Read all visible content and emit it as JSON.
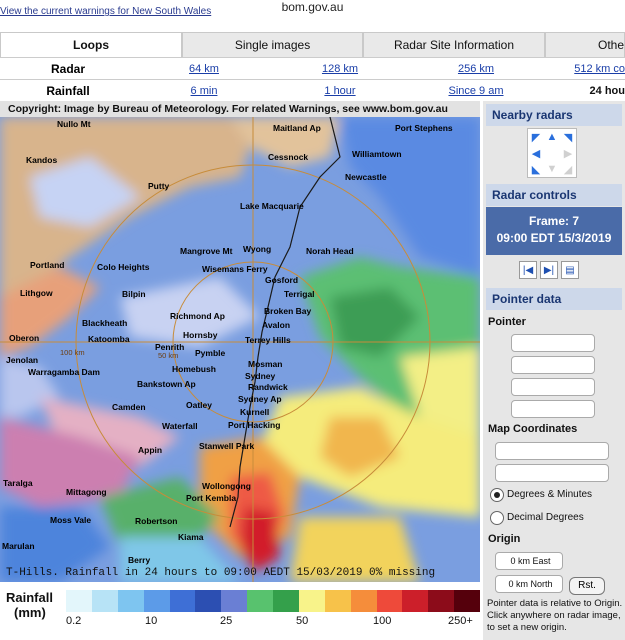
{
  "browser": {
    "url": "bom.gov.au",
    "warnings_link": "View the current warnings for New South Wales"
  },
  "tabs": [
    {
      "label": "Loops",
      "active": true
    },
    {
      "label": "Single images",
      "active": false
    },
    {
      "label": "Radar Site Information",
      "active": false
    },
    {
      "label": "Othe",
      "active": false
    }
  ],
  "radar_row": {
    "label": "Radar",
    "options": [
      "64 km",
      "128 km",
      "256 km",
      "512 km co"
    ]
  },
  "rainfall_row": {
    "label": "Rainfall",
    "options": [
      "6 min",
      "1 hour",
      "Since 9 am"
    ],
    "current": "24 hou"
  },
  "map": {
    "copyright": "Copyright: Image by Bureau of Meteorology. For related Warnings, see www.bom.gov.au",
    "caption": "T-Hills. Rainfall in 24 hours to 09:00 AEDT 15/03/2019 0% missing",
    "range_labels": [
      "100 km",
      "50 km"
    ],
    "places": [
      "Nullo Mt",
      "Maitland Ap",
      "Port Stephens",
      "Kandos",
      "Cessnock",
      "Williamtown",
      "Putty",
      "Newcastle",
      "Lake Macquarie",
      "Wyong",
      "Norah Head",
      "Mangrove Mt",
      "Portland",
      "Colo Heights",
      "Wisemans Ferry",
      "Gosford",
      "Lithgow",
      "Bilpin",
      "Terrigal",
      "Richmond Ap",
      "Broken Bay",
      "Blackheath",
      "Avalon",
      "Oberon",
      "Katoomba",
      "Penrith",
      "Hornsby",
      "Terrey Hills",
      "Pymble",
      "Jenolan",
      "Mosman",
      "Homebush",
      "Sydney",
      "Warragamba Dam",
      "Bankstown Ap",
      "Randwick",
      "Sydney Ap",
      "Camden",
      "Oatley",
      "Kurnell",
      "Waterfall",
      "Port Hacking",
      "Appin",
      "Stanwell Park",
      "Taralga",
      "Wollongong",
      "Mittagong",
      "Port Kembla",
      "Moss Vale",
      "Robertson",
      "Kiama",
      "Marulan",
      "Berry"
    ]
  },
  "legend": {
    "title_line1": "Rainfall",
    "title_line2": "(mm)",
    "colors": [
      "#e3f6fb",
      "#b7e3f6",
      "#7ec5f0",
      "#5c9be8",
      "#3e6fd6",
      "#2c4fb2",
      "#6a7fd4",
      "#58c26e",
      "#34a04b",
      "#f8f38a",
      "#f7c24a",
      "#f58d3b",
      "#ee4a3a",
      "#cc1f2a",
      "#8c0c1a",
      "#55000c"
    ],
    "ticks": [
      "0.2",
      "10",
      "25",
      "50",
      "100",
      "250+"
    ]
  },
  "sidebar": {
    "nearby_radars": "Nearby radars",
    "radar_controls": "Radar controls",
    "frame_label": "Frame: 7",
    "frame_time": "09:00 EDT 15/3/2019",
    "pointer_data": "Pointer data",
    "pointer": "Pointer",
    "map_coordinates": "Map Coordinates",
    "deg_minutes": "Degrees & Minutes",
    "decimal_degrees": "Decimal Degrees",
    "origin": "Origin",
    "origin_east": "0 km East",
    "origin_north": "0 km North",
    "reset": "Rst.",
    "note": "Pointer data is relative to Origin. Click anywhere on radar image, to set a new origin."
  },
  "colors": {
    "tab_active": "#ffffff",
    "tab_inactive": "#e9e9e9",
    "sidebar_header": "#cdd8ea",
    "frame_box": "#4a6ba8"
  },
  "icons": [
    "arrow-up-left-icon",
    "arrow-up-icon",
    "arrow-up-right-icon",
    "arrow-left-icon",
    "arrow-right-icon",
    "arrow-down-left-icon",
    "arrow-down-icon",
    "arrow-down-right-icon",
    "step-back-icon",
    "step-forward-icon",
    "print-icon"
  ]
}
